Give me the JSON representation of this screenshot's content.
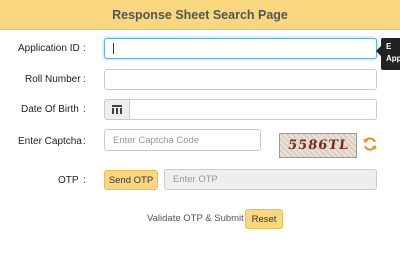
{
  "header": {
    "title": "Response Sheet Search Page"
  },
  "form": {
    "application_id": {
      "label": "Application ID",
      "colon": ":"
    },
    "roll_number": {
      "label": "Roll Number",
      "colon": ":"
    },
    "dob": {
      "label": "Date Of Birth",
      "colon": ":",
      "icon": "calendar-icon"
    },
    "captcha": {
      "label": "Enter Captcha",
      "colon": ":",
      "placeholder": "Enter Captcha Code",
      "image_text": "5586TL",
      "refresh_icon": "refresh-icon"
    },
    "otp": {
      "label": "OTP",
      "colon": ":",
      "send_button": "Send OTP",
      "placeholder": "Enter OTP"
    }
  },
  "footer": {
    "validate_label": "Validate OTP & Submit",
    "reset_button": "Reset"
  },
  "tooltip": {
    "line1": "E",
    "line2": "App"
  },
  "colors": {
    "accent": "#f9d77e",
    "refresh": "#f08a24",
    "focus": "#66afe9"
  }
}
